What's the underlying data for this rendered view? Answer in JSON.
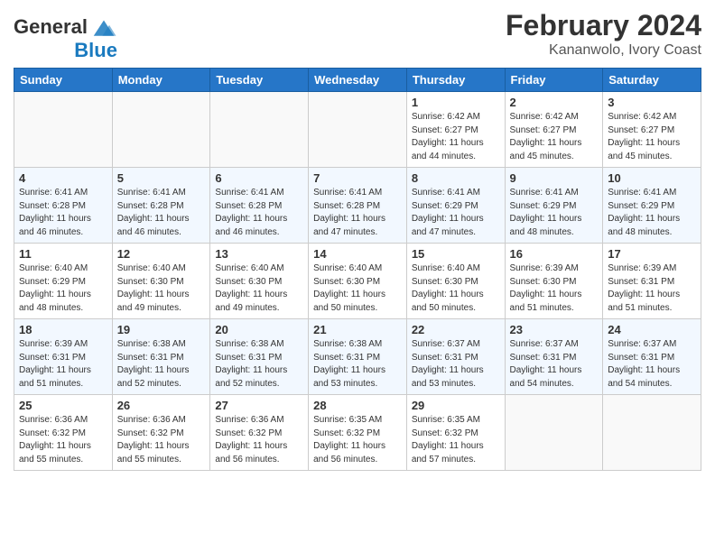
{
  "header": {
    "logo_text_general": "General",
    "logo_text_blue": "Blue",
    "month_year": "February 2024",
    "location": "Kananwolo, Ivory Coast"
  },
  "weekdays": [
    "Sunday",
    "Monday",
    "Tuesday",
    "Wednesday",
    "Thursday",
    "Friday",
    "Saturday"
  ],
  "weeks": [
    [
      {
        "day": "",
        "info": ""
      },
      {
        "day": "",
        "info": ""
      },
      {
        "day": "",
        "info": ""
      },
      {
        "day": "",
        "info": ""
      },
      {
        "day": "1",
        "info": "Sunrise: 6:42 AM\nSunset: 6:27 PM\nDaylight: 11 hours\nand 44 minutes."
      },
      {
        "day": "2",
        "info": "Sunrise: 6:42 AM\nSunset: 6:27 PM\nDaylight: 11 hours\nand 45 minutes."
      },
      {
        "day": "3",
        "info": "Sunrise: 6:42 AM\nSunset: 6:27 PM\nDaylight: 11 hours\nand 45 minutes."
      }
    ],
    [
      {
        "day": "4",
        "info": "Sunrise: 6:41 AM\nSunset: 6:28 PM\nDaylight: 11 hours\nand 46 minutes."
      },
      {
        "day": "5",
        "info": "Sunrise: 6:41 AM\nSunset: 6:28 PM\nDaylight: 11 hours\nand 46 minutes."
      },
      {
        "day": "6",
        "info": "Sunrise: 6:41 AM\nSunset: 6:28 PM\nDaylight: 11 hours\nand 46 minutes."
      },
      {
        "day": "7",
        "info": "Sunrise: 6:41 AM\nSunset: 6:28 PM\nDaylight: 11 hours\nand 47 minutes."
      },
      {
        "day": "8",
        "info": "Sunrise: 6:41 AM\nSunset: 6:29 PM\nDaylight: 11 hours\nand 47 minutes."
      },
      {
        "day": "9",
        "info": "Sunrise: 6:41 AM\nSunset: 6:29 PM\nDaylight: 11 hours\nand 48 minutes."
      },
      {
        "day": "10",
        "info": "Sunrise: 6:41 AM\nSunset: 6:29 PM\nDaylight: 11 hours\nand 48 minutes."
      }
    ],
    [
      {
        "day": "11",
        "info": "Sunrise: 6:40 AM\nSunset: 6:29 PM\nDaylight: 11 hours\nand 48 minutes."
      },
      {
        "day": "12",
        "info": "Sunrise: 6:40 AM\nSunset: 6:30 PM\nDaylight: 11 hours\nand 49 minutes."
      },
      {
        "day": "13",
        "info": "Sunrise: 6:40 AM\nSunset: 6:30 PM\nDaylight: 11 hours\nand 49 minutes."
      },
      {
        "day": "14",
        "info": "Sunrise: 6:40 AM\nSunset: 6:30 PM\nDaylight: 11 hours\nand 50 minutes."
      },
      {
        "day": "15",
        "info": "Sunrise: 6:40 AM\nSunset: 6:30 PM\nDaylight: 11 hours\nand 50 minutes."
      },
      {
        "day": "16",
        "info": "Sunrise: 6:39 AM\nSunset: 6:30 PM\nDaylight: 11 hours\nand 51 minutes."
      },
      {
        "day": "17",
        "info": "Sunrise: 6:39 AM\nSunset: 6:31 PM\nDaylight: 11 hours\nand 51 minutes."
      }
    ],
    [
      {
        "day": "18",
        "info": "Sunrise: 6:39 AM\nSunset: 6:31 PM\nDaylight: 11 hours\nand 51 minutes."
      },
      {
        "day": "19",
        "info": "Sunrise: 6:38 AM\nSunset: 6:31 PM\nDaylight: 11 hours\nand 52 minutes."
      },
      {
        "day": "20",
        "info": "Sunrise: 6:38 AM\nSunset: 6:31 PM\nDaylight: 11 hours\nand 52 minutes."
      },
      {
        "day": "21",
        "info": "Sunrise: 6:38 AM\nSunset: 6:31 PM\nDaylight: 11 hours\nand 53 minutes."
      },
      {
        "day": "22",
        "info": "Sunrise: 6:37 AM\nSunset: 6:31 PM\nDaylight: 11 hours\nand 53 minutes."
      },
      {
        "day": "23",
        "info": "Sunrise: 6:37 AM\nSunset: 6:31 PM\nDaylight: 11 hours\nand 54 minutes."
      },
      {
        "day": "24",
        "info": "Sunrise: 6:37 AM\nSunset: 6:31 PM\nDaylight: 11 hours\nand 54 minutes."
      }
    ],
    [
      {
        "day": "25",
        "info": "Sunrise: 6:36 AM\nSunset: 6:32 PM\nDaylight: 11 hours\nand 55 minutes."
      },
      {
        "day": "26",
        "info": "Sunrise: 6:36 AM\nSunset: 6:32 PM\nDaylight: 11 hours\nand 55 minutes."
      },
      {
        "day": "27",
        "info": "Sunrise: 6:36 AM\nSunset: 6:32 PM\nDaylight: 11 hours\nand 56 minutes."
      },
      {
        "day": "28",
        "info": "Sunrise: 6:35 AM\nSunset: 6:32 PM\nDaylight: 11 hours\nand 56 minutes."
      },
      {
        "day": "29",
        "info": "Sunrise: 6:35 AM\nSunset: 6:32 PM\nDaylight: 11 hours\nand 57 minutes."
      },
      {
        "day": "",
        "info": ""
      },
      {
        "day": "",
        "info": ""
      }
    ]
  ]
}
